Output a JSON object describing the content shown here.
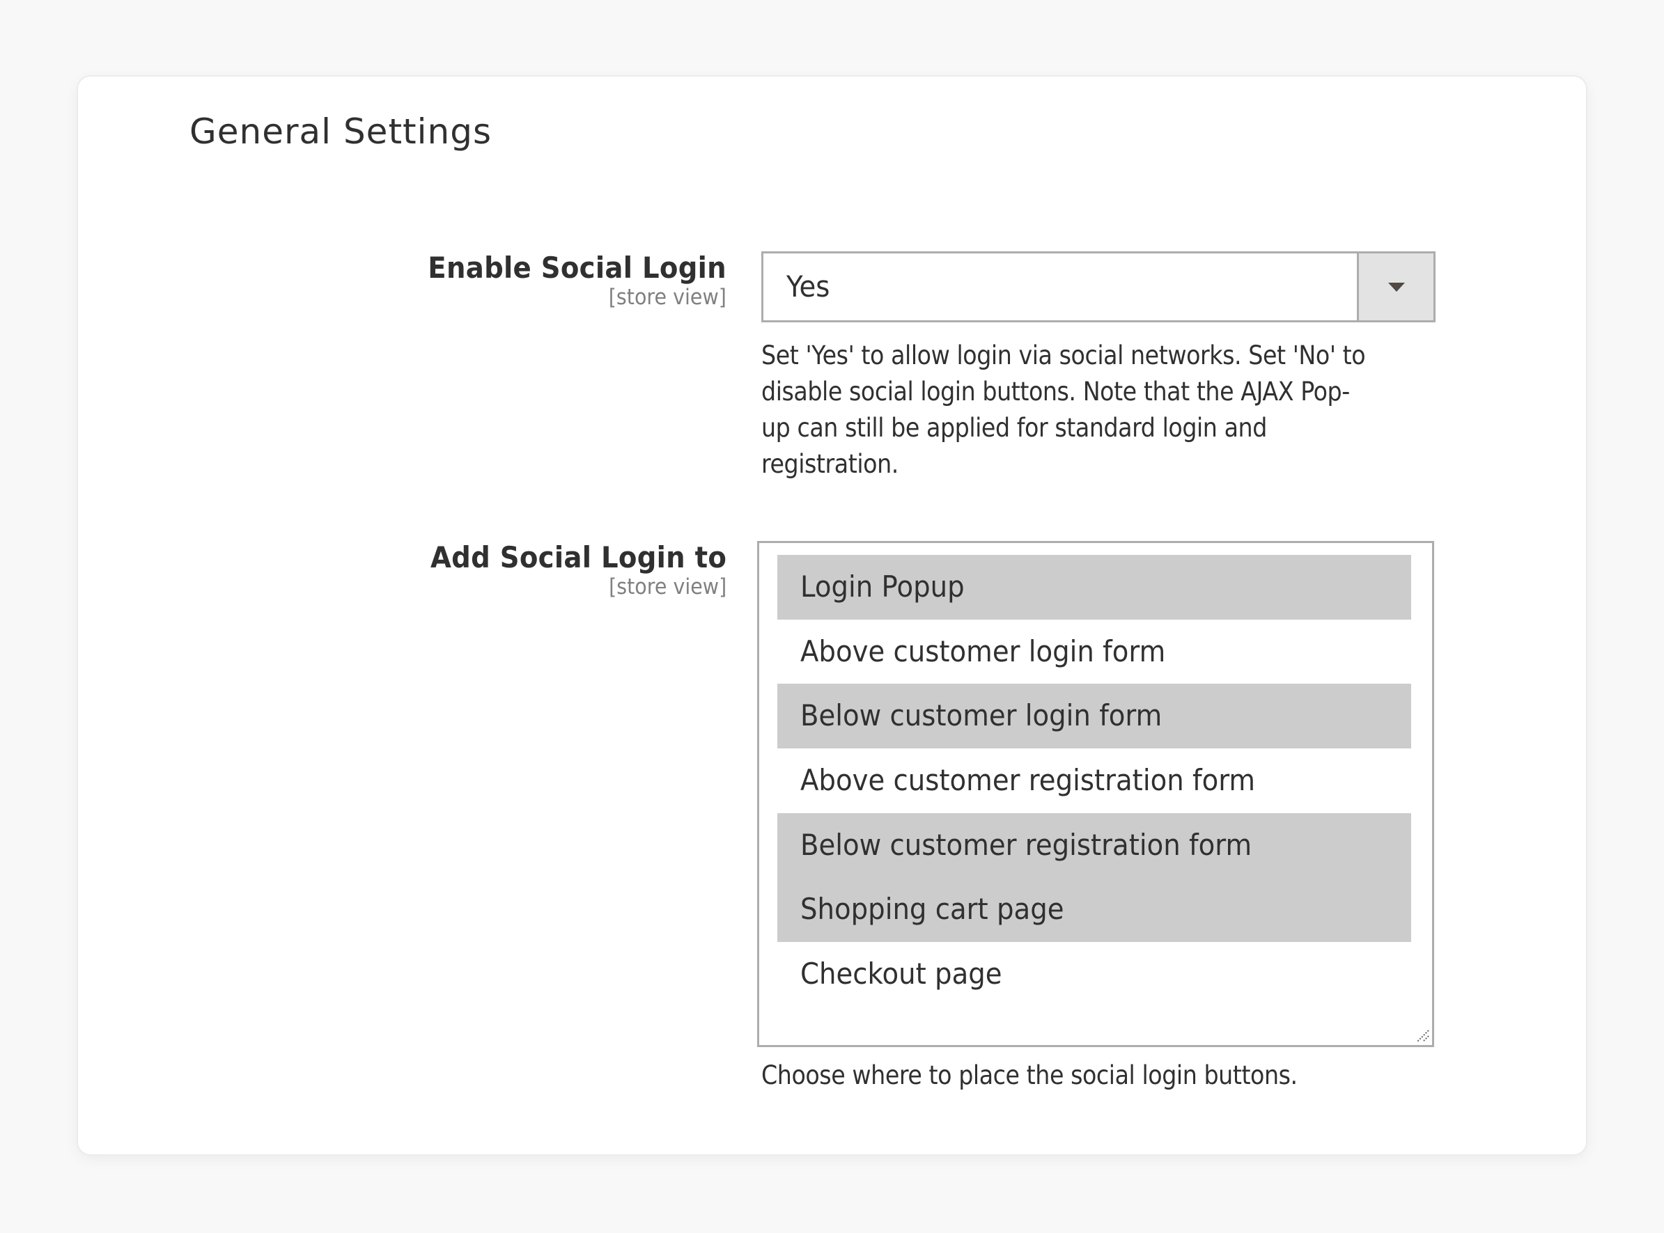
{
  "section": {
    "title": "General Settings"
  },
  "fields": {
    "enable_social_login": {
      "label": "Enable Social Login",
      "scope": "[store view]",
      "value": "Yes",
      "note": "Set 'Yes' to allow login via social networks. Set 'No' to disable social login buttons. Note that the AJAX Pop-up can still be applied for standard login and registration."
    },
    "add_social_login_to": {
      "label": "Add Social Login to",
      "scope": "[store view]",
      "options": [
        {
          "label": "Login Popup",
          "selected": true
        },
        {
          "label": "Above customer login form",
          "selected": false
        },
        {
          "label": "Below customer login form",
          "selected": true
        },
        {
          "label": "Above customer registration form",
          "selected": false
        },
        {
          "label": "Below customer registration form",
          "selected": true
        },
        {
          "label": "Shopping cart page",
          "selected": true
        },
        {
          "label": "Checkout page",
          "selected": false
        }
      ],
      "note": "Choose where to place the social login buttons."
    }
  },
  "icons": {
    "select_arrow": "chevron-down-icon",
    "resize": "resize-grip-icon"
  },
  "colors": {
    "selected_option": "#cccccc",
    "border": "#adadad",
    "select_button": "#e3e3e3",
    "text": "#303030",
    "scope_text": "#808080"
  }
}
